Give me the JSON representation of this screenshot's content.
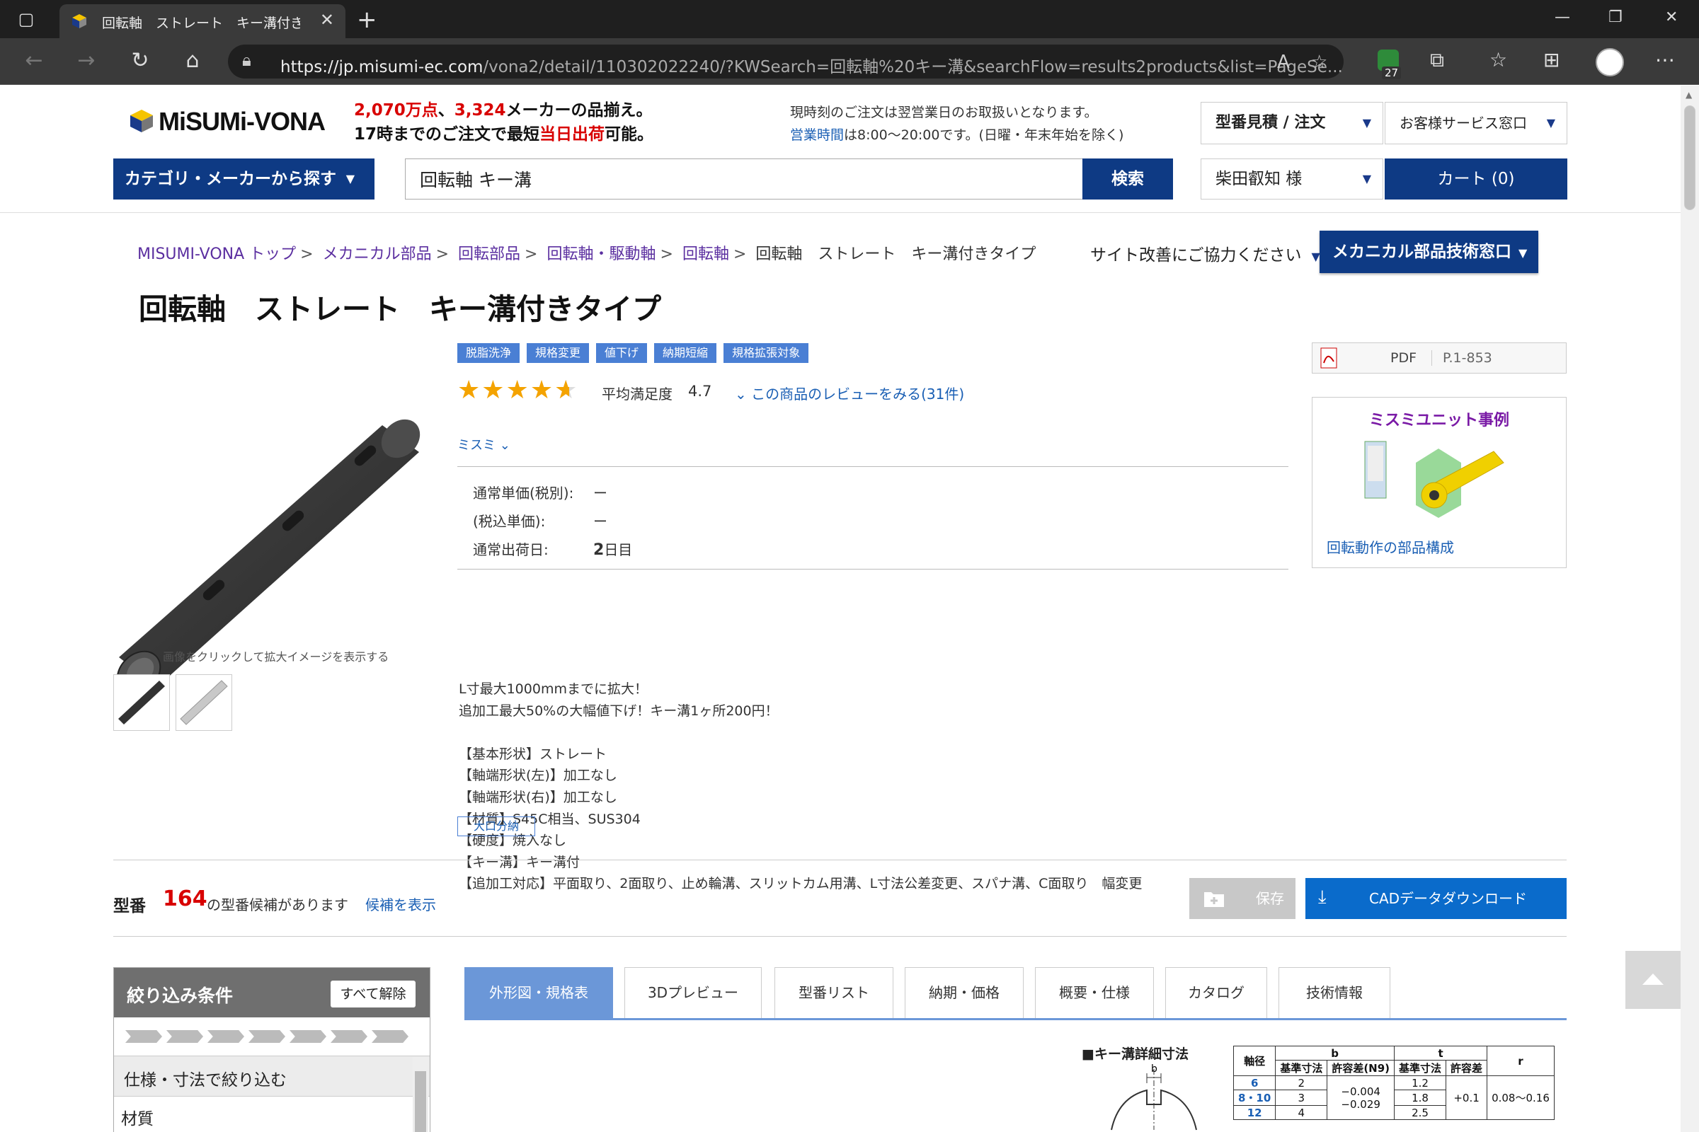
{
  "browser": {
    "tab_title": "回転軸　ストレート　キー溝付きタイプ",
    "url_host": "https://jp.misumi-ec.com",
    "url_path": "/vona2/detail/110302022240/?KWSearch=回転軸%20キー溝&searchFlow=results2products&list=PageSe...",
    "extension_badge": "27"
  },
  "header": {
    "logo": "MiSUMi-VONA",
    "promo_line1_red1": "2,070万点",
    "promo_line1_mid": "、",
    "promo_line1_red2": "3,324",
    "promo_line1_end": "メーカーの品揃え。",
    "promo_line2_start": "17時までのご注文で最短",
    "promo_line2_red": "当日出荷",
    "promo_line2_end": "可能。",
    "notice_line1": "現時刻のご注文は翌営業日のお取扱いとなります。",
    "notice_link": "営業時間",
    "notice_line2_rest": "は8:00～20:00です。(日曜・年末年始を除く)",
    "quote_dd": "型番見積 / 注文",
    "service_dd": "お客様サービス窓口",
    "category_btn": "カテゴリ・メーカーから探す",
    "search_value": "回転軸 キー溝",
    "search_btn": "検索",
    "user_dd": "柴田叡知 様",
    "cart_btn": "カート (0)"
  },
  "breadcrumb": [
    "MISUMI-VONA トップ",
    "メカニカル部品",
    "回転部品",
    "回転軸・駆動軸",
    "回転軸"
  ],
  "breadcrumb_current": "回転軸　ストレート　キー溝付きタイプ",
  "improve_link": "サイト改善にご協力ください",
  "tech_btn": "メカニカル部品技術窓口",
  "product": {
    "title": "回転軸　ストレート　キー溝付きタイプ",
    "image_caption": "画像をクリックして拡大イメージを表示する",
    "tags": [
      "脱脂洗浄",
      "規格変更",
      "値下げ",
      "納期短縮",
      "規格拡張対象"
    ],
    "rating": 4.7,
    "rating_label": "平均満足度",
    "rating_value": "4.7",
    "review_link": "この商品のレビューをみる(31件)",
    "brand": "ミスミ",
    "price_label": "通常単価(税別):",
    "price_value": "ー",
    "tax_label": "(税込単価):",
    "tax_value": "ー",
    "ship_label": "通常出荷日:",
    "ship_num": "2",
    "ship_unit": "日目",
    "description": "L寸最大1000mmまでに拡大！\n追加工最大50%の大幅値下げ！キー溝1ヶ所200円！\n\n【基本形状】ストレート\n【軸端形状(左)】加工なし\n【軸端形状(右)】加工なし\n【材質】S45C相当、SUS304\n【硬度】焼入なし\n【キー溝】キー溝付\n【追加工対応】平面取り、2面取り、止め輪溝、スリットカム用溝、L寸法公差変更、スパナ溝、C面取り　幅変更",
    "bulk_tag": "大口分納"
  },
  "side": {
    "pdf_label": "PDF",
    "pdf_page": "P.1-853",
    "unit_title": "ミスミユニット事例",
    "unit_link": "回転動作の部品構成"
  },
  "model": {
    "label": "型番",
    "count": "164",
    "text": "の型番候補があります",
    "link": "候補を表示",
    "save_btn": "保存",
    "cad_btn": "CADデータダウンロード"
  },
  "filter": {
    "title": "絞り込み条件",
    "clear_btn": "すべて解除",
    "section": "仕様・寸法で絞り込む",
    "item": "材質"
  },
  "tabs": [
    "外形図・規格表",
    "3Dプレビュー",
    "型番リスト",
    "納期・価格",
    "概要・仕様",
    "カタログ",
    "技術情報"
  ],
  "spec": {
    "title": "■キー溝詳細寸法",
    "head_axis": "軸径",
    "head_b": "b",
    "head_t": "t",
    "head_r": "r",
    "head_std": "基準寸法",
    "head_tol": "許容差",
    "head_tol_n9": "許容差(N9)",
    "rows": [
      {
        "d": "6",
        "b": "2",
        "t": "1.2"
      },
      {
        "d": "8・10",
        "b": "3",
        "t": "1.8"
      },
      {
        "d": "12",
        "b": "4",
        "t": "2.5"
      }
    ],
    "b_tol": "−0.004\n−0.029",
    "t_tol": "+0.1",
    "r_val": "0.08～0.16",
    "drawing_label": "b"
  },
  "colors": {
    "brand_navy": "#0e3a84",
    "link_blue": "#1a5fb4",
    "tag_blue": "#4a7fd4",
    "red": "#d80000",
    "star": "#f4a300",
    "tab_active": "#6b97d8"
  }
}
